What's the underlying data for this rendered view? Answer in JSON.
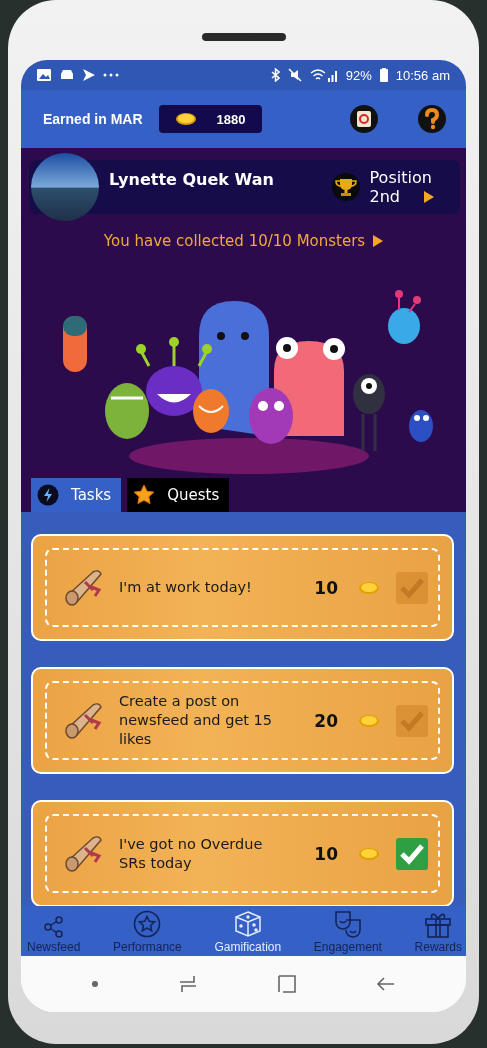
{
  "status_bar": {
    "battery": "92%",
    "time": "10:56 am"
  },
  "header": {
    "label": "Earned in MAR",
    "coins": "1880"
  },
  "profile": {
    "name": "Lynette Quek Wan",
    "position_label": "Position",
    "position": "2nd"
  },
  "collection_link": "You have collected 10/10 Monsters",
  "tabs": [
    {
      "label": "Tasks",
      "selected": true,
      "kind": "bolt"
    },
    {
      "label": "Quests",
      "selected": false,
      "kind": "star"
    }
  ],
  "tasks": [
    {
      "text": "I'm at work today!",
      "points": "10",
      "checked": false
    },
    {
      "text": "Create a post on newsfeed and get 15 likes",
      "points": "20",
      "checked": false
    },
    {
      "text": "I've got no Overdue SRs today",
      "points": "10",
      "checked": true
    }
  ],
  "bottom_nav": [
    {
      "label": "Newsfeed",
      "selected": false,
      "kind": "share"
    },
    {
      "label": "Performance",
      "selected": false,
      "kind": "star"
    },
    {
      "label": "Gamification",
      "selected": true,
      "kind": "dice"
    },
    {
      "label": "Engagement",
      "selected": false,
      "kind": "masks"
    },
    {
      "label": "Rewards",
      "selected": false,
      "kind": "gift"
    }
  ]
}
